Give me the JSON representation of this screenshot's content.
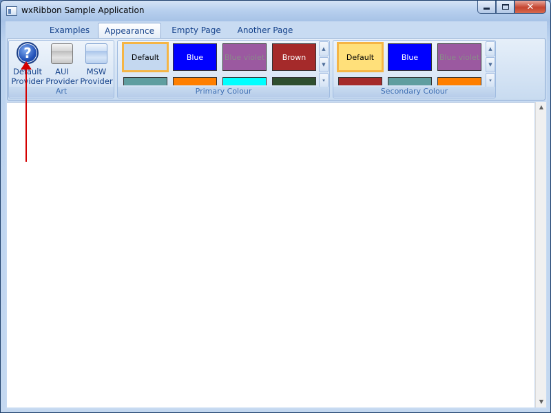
{
  "window": {
    "title": "wxRibbon Sample Application",
    "icon": "app-window-icon",
    "close_glyph": "✕"
  },
  "tabs": [
    {
      "label": "Examples",
      "active": false
    },
    {
      "label": "Appearance",
      "active": true
    },
    {
      "label": "Empty Page",
      "active": false
    },
    {
      "label": "Another Page",
      "active": false
    }
  ],
  "panels": {
    "art": {
      "label": "Art",
      "buttons": [
        {
          "line1": "Default",
          "line2": "Provider",
          "icon": "help-icon"
        },
        {
          "line1": "AUI",
          "line2": "Provider",
          "icon": "aui-provider-icon"
        },
        {
          "line1": "MSW",
          "line2": "Provider",
          "icon": "msw-provider-icon"
        }
      ]
    },
    "primary": {
      "label": "Primary Colour",
      "swatches": [
        {
          "label": "Default",
          "bg": "#c4d8f0",
          "fg": "#000000",
          "selected": true
        },
        {
          "label": "Blue",
          "bg": "#0000ff",
          "fg": "#ffffff",
          "selected": false
        },
        {
          "label": "Blue violet",
          "bg": "#9b59a0",
          "fg": "#8a8a8a",
          "selected": false
        },
        {
          "label": "Brown",
          "bg": "#a52a2a",
          "fg": "#ffffff",
          "selected": false
        }
      ],
      "row2_colors": [
        "#5f9ea0",
        "#ff7f00",
        "#00ffff",
        "#2f4f2f"
      ]
    },
    "secondary": {
      "label": "Secondary Colour",
      "swatches": [
        {
          "label": "Default",
          "bg": "#ffe07a",
          "fg": "#000000",
          "selected": true
        },
        {
          "label": "Blue",
          "bg": "#0000ff",
          "fg": "#ffffff",
          "selected": false
        },
        {
          "label": "Blue violet",
          "bg": "#9b59a0",
          "fg": "#8a8a8a",
          "selected": false
        }
      ],
      "row2_colors": [
        "#a52a2a",
        "#5f9ea0",
        "#ff7f00"
      ]
    }
  },
  "colors": {
    "annotation_arrow": "#d40000",
    "selection_outline": "#f5b545"
  }
}
